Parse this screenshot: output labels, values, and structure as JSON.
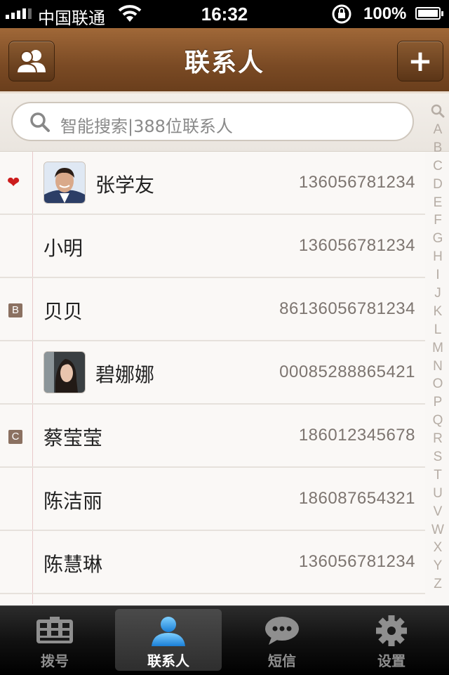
{
  "status_bar": {
    "carrier": "中国联通",
    "time": "16:32",
    "battery": "100%",
    "icons": [
      "signal-icon",
      "wifi-icon",
      "rotation-lock-icon",
      "battery-icon"
    ]
  },
  "nav": {
    "title": "联系人",
    "left_button_icon": "contacts-group-icon",
    "right_button_icon": "plus-icon"
  },
  "search": {
    "placeholder": "智能搜索|388位联系人"
  },
  "index_letters": [
    "A",
    "B",
    "C",
    "D",
    "E",
    "F",
    "G",
    "H",
    "I",
    "J",
    "K",
    "L",
    "M",
    "N",
    "O",
    "P",
    "Q",
    "R",
    "S",
    "T",
    "U",
    "V",
    "W",
    "X",
    "Y",
    "Z"
  ],
  "contacts": [
    {
      "marker": "heart",
      "name": "张学友",
      "phone": "136056781234",
      "has_avatar": true
    },
    {
      "marker": "",
      "name": "小明",
      "phone": "136056781234",
      "has_avatar": false
    },
    {
      "marker": "B",
      "name": "贝贝",
      "phone": "86136056781234",
      "has_avatar": false
    },
    {
      "marker": "",
      "name": "碧娜娜",
      "phone": "00085288865421",
      "has_avatar": true
    },
    {
      "marker": "C",
      "name": "蔡莹莹",
      "phone": "186012345678",
      "has_avatar": false
    },
    {
      "marker": "",
      "name": "陈洁丽",
      "phone": "186087654321",
      "has_avatar": false
    },
    {
      "marker": "",
      "name": "陈慧琳",
      "phone": "136056781234",
      "has_avatar": false
    }
  ],
  "tabs": [
    {
      "label": "拨号",
      "icon": "keypad-icon",
      "active": false
    },
    {
      "label": "联系人",
      "icon": "person-icon",
      "active": true
    },
    {
      "label": "短信",
      "icon": "message-bubble-icon",
      "active": false
    },
    {
      "label": "设置",
      "icon": "gear-icon",
      "active": false
    }
  ],
  "colors": {
    "nav_brown": "#7a4a24",
    "index_letter": "#b5aca4",
    "badge_brown": "#8b7161",
    "heart_red": "#cc1d1d"
  }
}
